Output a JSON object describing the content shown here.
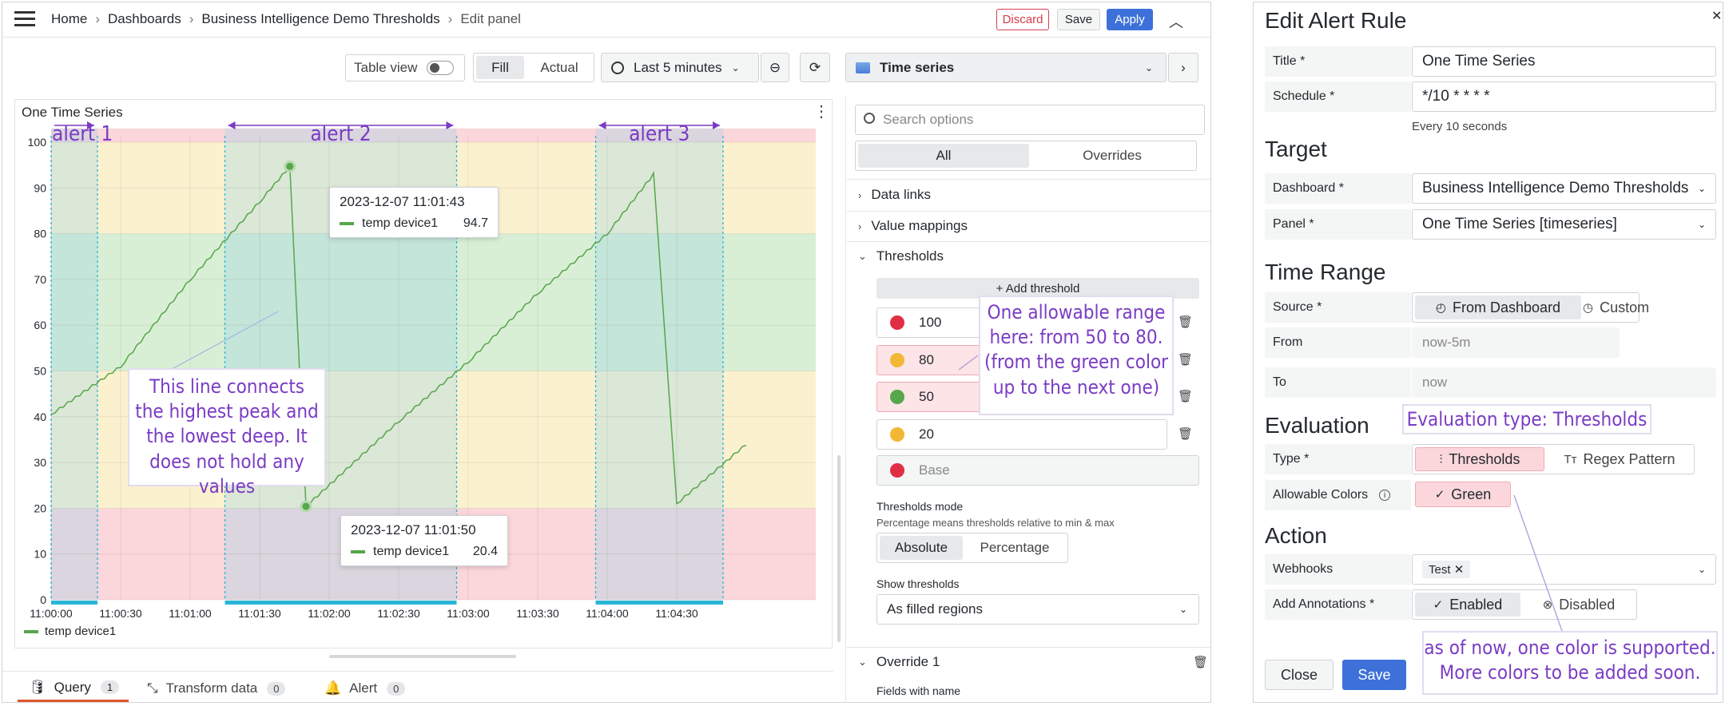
{
  "colors": {
    "accent": "#3d71d9",
    "discard": "#d63e4f",
    "threshold_red": "#e02f44",
    "threshold_yellow": "#f2b735",
    "threshold_green": "#56a64b",
    "series_line": "#56a64b",
    "annotation_purple": "#7a3cc4",
    "cyan": "#29b6d6"
  },
  "topbar": {
    "breadcrumb": [
      "Home",
      "Dashboards",
      "Business Intelligence Demo Thresholds",
      "Edit panel"
    ],
    "discard": "Discard",
    "save": "Save",
    "apply": "Apply"
  },
  "toolbar": {
    "table_view": "Table view",
    "fill": "Fill",
    "actual": "Actual",
    "time_range": "Last 5 minutes",
    "viz_type": "Time series"
  },
  "panel": {
    "title": "One Time Series",
    "legend": "temp device1"
  },
  "chart_data": {
    "type": "line",
    "title": "One Time Series",
    "x_ticks": [
      "11:00:00",
      "11:00:30",
      "11:01:00",
      "11:01:30",
      "11:02:00",
      "11:02:30",
      "11:03:00",
      "11:03:30",
      "11:04:00",
      "11:04:30"
    ],
    "y_ticks": [
      0,
      10,
      20,
      30,
      40,
      50,
      60,
      70,
      80,
      90,
      100
    ],
    "ylim": [
      0,
      100
    ],
    "series": [
      {
        "name": "temp device1",
        "points": [
          [
            "11:00:00",
            40.5
          ],
          [
            "11:00:30",
            51
          ],
          [
            "11:01:00",
            70
          ],
          [
            "11:01:30",
            87
          ],
          [
            "11:01:43",
            94.7
          ],
          [
            "11:01:50",
            20.4
          ],
          [
            "11:02:30",
            39
          ],
          [
            "11:03:00",
            52
          ],
          [
            "11:03:30",
            67
          ],
          [
            "11:04:00",
            80
          ],
          [
            "11:04:20",
            93
          ],
          [
            "11:04:30",
            21
          ],
          [
            "11:05:00",
            34
          ]
        ]
      }
    ],
    "thresholds": [
      {
        "value": 100,
        "color": "red"
      },
      {
        "value": 80,
        "color": "yellow"
      },
      {
        "value": 50,
        "color": "green"
      },
      {
        "value": 20,
        "color": "yellow"
      },
      {
        "value": "Base",
        "color": "red"
      }
    ],
    "alert_windows": [
      {
        "label": "alert 1",
        "from": "11:00:00",
        "to": "11:00:20"
      },
      {
        "label": "alert 2",
        "from": "11:01:15",
        "to": "11:02:55"
      },
      {
        "label": "alert 3",
        "from": "11:03:55",
        "to": "11:04:50"
      }
    ],
    "grid": true,
    "legend_position": "bottom-left"
  },
  "tooltips": [
    {
      "time": "2023-12-07 11:01:43",
      "series": "temp device1",
      "value": "94.7"
    },
    {
      "time": "2023-12-07 11:01:50",
      "series": "temp device1",
      "value": "20.4"
    }
  ],
  "chart_notes": {
    "line_note": "This line connects the highest peak and the lowest deep. It does not hold any values",
    "range_note": "One allowable range here: from 50 to 80. (from the green color up to the next one)",
    "eval_note": "Evaluation type: Thresholds",
    "color_note": "as of now, one color is supported. More colors to be added soon."
  },
  "options": {
    "search_placeholder": "Search options",
    "tab_all": "All",
    "tab_overrides": "Overrides",
    "data_links": "Data links",
    "value_mappings": "Value mappings",
    "thresholds": "Thresholds",
    "add_threshold": "+ Add threshold",
    "threshold_values": [
      "100",
      "80",
      "50",
      "20",
      "Base"
    ],
    "thresholds_mode_label": "Thresholds mode",
    "thresholds_mode_desc": "Percentage means thresholds relative to min & max",
    "absolute": "Absolute",
    "percentage": "Percentage",
    "show_thresholds_label": "Show thresholds",
    "show_thresholds_value": "As filled regions",
    "override": "Override 1",
    "fields_with_name": "Fields with name"
  },
  "bottom_tabs": [
    {
      "label": "Query",
      "count": "1"
    },
    {
      "label": "Transform data",
      "count": "0"
    },
    {
      "label": "Alert",
      "count": "0"
    }
  ],
  "alert_rule": {
    "heading": "Edit Alert Rule",
    "title_label": "Title *",
    "title_value": "One Time Series",
    "schedule_label": "Schedule *",
    "schedule_value": "*/10 * * * *",
    "schedule_hint": "Every 10 seconds",
    "target": "Target",
    "dashboard_label": "Dashboard *",
    "dashboard_value": "Business Intelligence Demo Thresholds",
    "panel_label": "Panel *",
    "panel_value": "One Time Series [timeseries]",
    "time_range": "Time Range",
    "source_label": "Source *",
    "from_dashboard": "From Dashboard",
    "custom": "Custom",
    "from_label": "From",
    "from_value": "now-5m",
    "to_label": "To",
    "to_value": "now",
    "evaluation": "Evaluation",
    "type_label": "Type *",
    "type_thresholds": "Thresholds",
    "type_regex": "Regex Pattern",
    "allowable_label": "Allowable Colors",
    "allowable_value": "Green",
    "action": "Action",
    "webhooks_label": "Webhooks",
    "webhook_tag": "Test",
    "annotations_label": "Add Annotations *",
    "enabled": "Enabled",
    "disabled": "Disabled",
    "close": "Close",
    "save": "Save"
  }
}
